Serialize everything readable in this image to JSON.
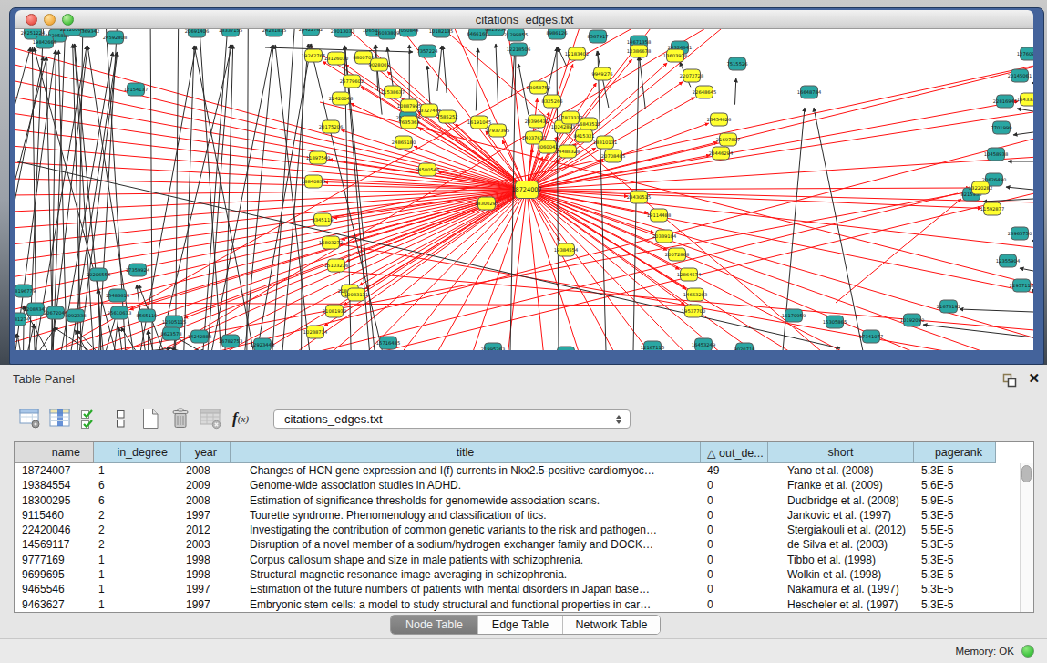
{
  "window": {
    "title": "citations_edges.txt"
  },
  "table_panel": {
    "title": "Table Panel",
    "toolbar": {
      "icons": [
        "table-settings",
        "column-selector",
        "select-rows",
        "row-height",
        "new-table",
        "delete-table",
        "delete-column",
        "function-builder"
      ],
      "combo_value": "citations_edges.txt"
    },
    "table": {
      "columns": [
        "name",
        "in_degree",
        "year",
        "title",
        "out_de...",
        "short",
        "pagerank"
      ],
      "sort_indicator": "△",
      "sort_column": "out_de...",
      "rows": [
        [
          "18724007",
          "1",
          "2008",
          "Changes of HCN gene expression and I(f) currents in Nkx2.5-positive cardiomyoc…",
          "49",
          "Yano et al. (2008)",
          "5.3E-5"
        ],
        [
          "19384554",
          "6",
          "2009",
          "Genome-wide association studies in ADHD.",
          "0",
          "Franke et al. (2009)",
          "5.6E-5"
        ],
        [
          "18300295",
          "6",
          "2008",
          "Estimation of significance thresholds for genomewide association scans.",
          "0",
          "Dudbridge et al. (2008)",
          "5.9E-5"
        ],
        [
          "9115460",
          "2",
          "1997",
          "Tourette syndrome. Phenomenology and classification of tics.",
          "0",
          "Jankovic et al. (1997)",
          "5.3E-5"
        ],
        [
          "22420046",
          "2",
          "2012",
          "Investigating the contribution of common genetic variants to the risk and pathogen…",
          "0",
          "Stergiakouli et al. (2012)",
          "5.5E-5"
        ],
        [
          "14569117",
          "2",
          "2003",
          "Disruption of a novel member of a sodium/hydrogen exchanger family and DOCK…",
          "0",
          "de Silva et al. (2003)",
          "5.3E-5"
        ],
        [
          "9777169",
          "1",
          "1998",
          "Corpus callosum shape and size in male patients with schizophrenia.",
          "0",
          "Tibbo et al. (1998)",
          "5.3E-5"
        ],
        [
          "9699695",
          "1",
          "1998",
          "Structural magnetic resonance image averaging in schizophrenia.",
          "0",
          "Wolkin et al. (1998)",
          "5.3E-5"
        ],
        [
          "9465546",
          "1",
          "1997",
          "Estimation of the future numbers of patients with mental disorders in Japan base…",
          "0",
          "Nakamura et al. (1997)",
          "5.3E-5"
        ],
        [
          "9463627",
          "1",
          "1997",
          "Embryonic stem cells: a model to study structural and functional properties in car…",
          "0",
          "Hescheler et al. (1997)",
          "5.3E-5"
        ]
      ]
    },
    "tabs": [
      {
        "label": "Node Table",
        "selected": true
      },
      {
        "label": "Edge Table",
        "selected": false
      },
      {
        "label": "Network Table",
        "selected": false
      }
    ]
  },
  "status_bar": {
    "memory_label": "Memory: OK"
  },
  "graph": {
    "center_label": "18724007",
    "known_labels": [
      "18300295",
      "19384554",
      "22420046",
      "16033809",
      "7357224",
      "8813054",
      "12218506",
      "21053346",
      "16648784",
      "8215955",
      "15716485",
      "20691406",
      "10653287",
      "6466160",
      "14671358",
      "7515526",
      "20206556",
      "17359924",
      "12505115",
      "16782753",
      "12923448"
    ],
    "colors": {
      "node_teal": "#2aa7a3",
      "node_yellow": "#ffff2f",
      "edge_red": "#ff1010",
      "edge_black": "#2b2b2b",
      "node_border": "#5a5a5a"
    },
    "seed": 7
  }
}
